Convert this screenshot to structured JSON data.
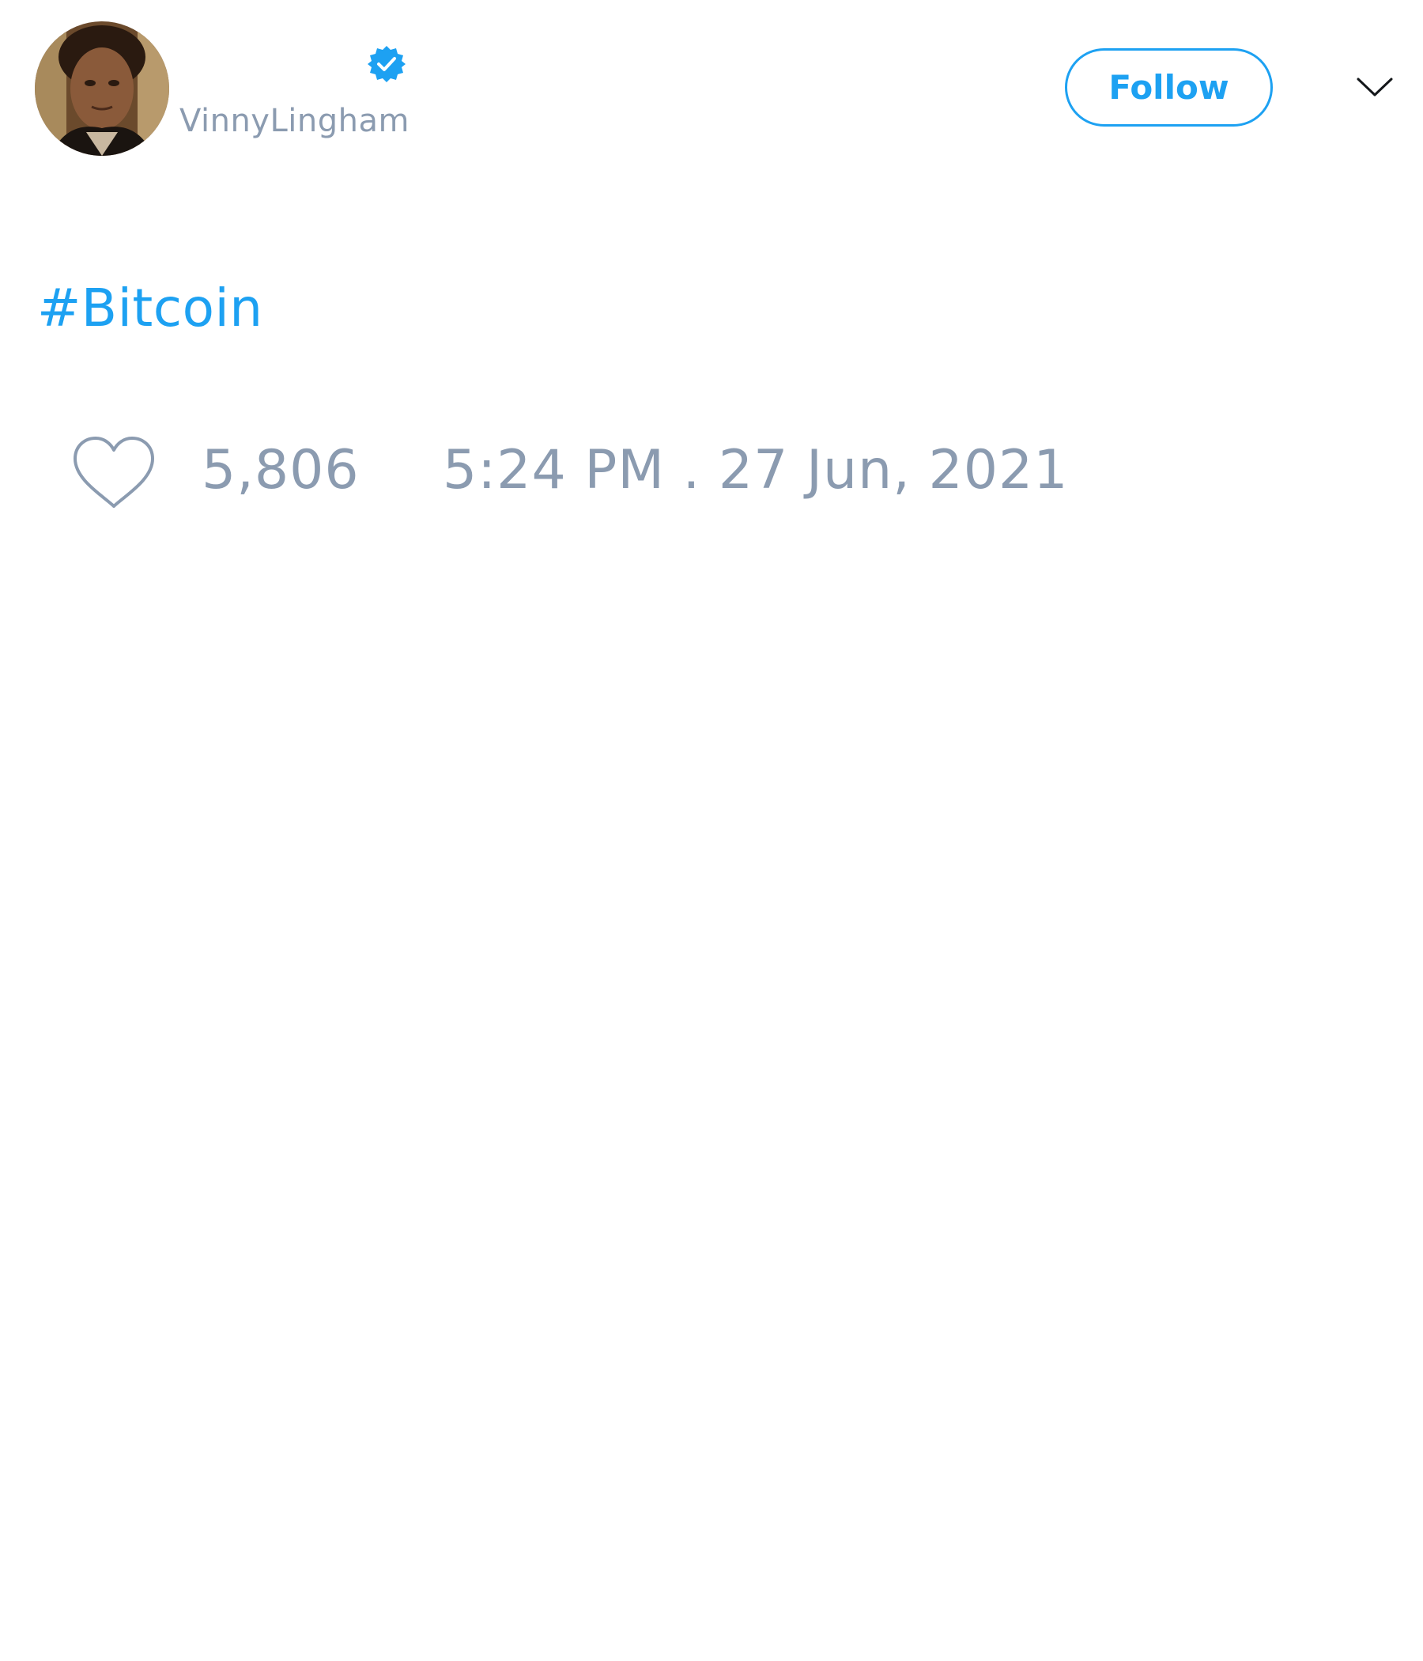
{
  "author": {
    "display_name": "",
    "handle": "VinnyLingham",
    "verified": true
  },
  "actions": {
    "follow_label": "Follow"
  },
  "tweet": {
    "text": "#Bitcoin",
    "like_count": "5,806",
    "timestamp": "5:24 PM . 27 Jun, 2021"
  },
  "icons": {
    "verified": "verified-badge-icon",
    "caret": "chevron-down-icon",
    "like": "heart-icon"
  },
  "colors": {
    "accent": "#1da1f2",
    "muted": "#8b9bb0",
    "text": "#14171a",
    "background": "#ffffff"
  }
}
